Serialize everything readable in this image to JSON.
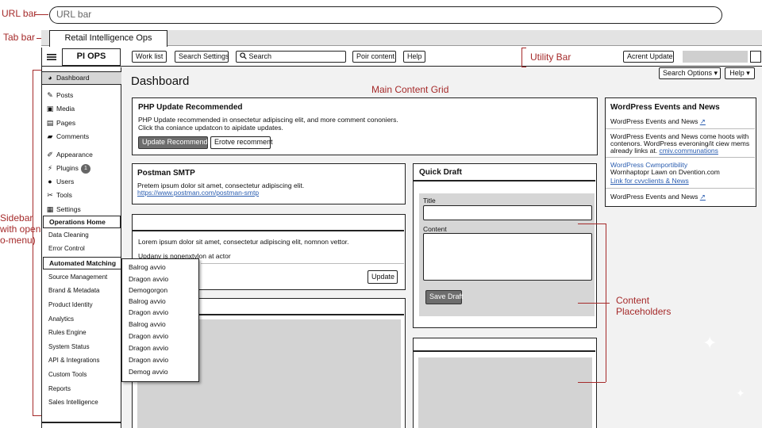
{
  "annotations": {
    "url_bar": "URL bar",
    "tab_bar": "Tab bar",
    "utility_bar": "Utility Bar",
    "main_grid": "Main Content Grid",
    "sidebar_lines": [
      "Sidebar",
      "with open",
      "o-menu)"
    ],
    "content_placeholders": [
      "Content",
      "Placeholders"
    ]
  },
  "browser": {
    "url_placeholder": "URL bar",
    "tab_title": "Retail Intelligence Ops"
  },
  "topbar": {
    "brand": "PI OPS",
    "work_list": "Work list",
    "search_settings": "Search Settings",
    "search_placeholder": "Search",
    "poir_content": "Poir content",
    "help": "Help",
    "acrent_update": "Acrent Update"
  },
  "sidebar": {
    "items": [
      {
        "label": "Dashboard",
        "icon": "gauge-icon"
      },
      {
        "label": "Posts",
        "icon": "pin-icon"
      },
      {
        "label": "Media",
        "icon": "media-icon"
      },
      {
        "label": "Pages",
        "icon": "pages-icon"
      },
      {
        "label": "Comments",
        "icon": "comment-icon"
      },
      {
        "label": "Appearance",
        "icon": "brush-icon"
      },
      {
        "label": "Plugins",
        "icon": "plugin-icon",
        "badge": "1"
      },
      {
        "label": "Users",
        "icon": "user-icon"
      },
      {
        "label": "Tools",
        "icon": "wrench-icon"
      },
      {
        "label": "Settings",
        "icon": "settings-icon"
      }
    ],
    "group1_head": "Operations Home",
    "group1_items": [
      "Data Cleaning",
      "Error Control"
    ],
    "group2_head": "Automated Matching",
    "group2_items": [
      "Source Management",
      "Brand & Metadata",
      "Product Identity",
      "Analytics",
      "Rules Engine",
      "System Status",
      "API & Integrations",
      "Custom Tools",
      "Reports",
      "Sales Intelligence"
    ]
  },
  "submenu": {
    "items": [
      "Balrog avvio",
      "Dragon avvio",
      "Demogorgon",
      "Balrog avvio",
      "Dragon avvio",
      "Balrog avvio",
      "Dragon avvio",
      "Dragon avvio",
      "Dragon avvio",
      "Demog avvio"
    ]
  },
  "main": {
    "title": "Dashboard",
    "search_options": "Search Options ▾",
    "help": "Help ▾",
    "php": {
      "title": "PHP Update Recommended",
      "line1": "PHP Update recommended in onsectetur adipiscing elit, and more comment cononiers.",
      "line2": "Click tha coniance updatcon to aipidate updates.",
      "btn_update": "Update Recommended",
      "btn_other": "Erotve recomment"
    },
    "smtp": {
      "title": "Postman SMTP",
      "line1": "Pretem ipsum dolor sit amet, consectetur adipiscing elit.",
      "link": "https://www.postman.com/postman-smtp"
    },
    "lorem": {
      "line1": "Lorem ipsum dolor sit amet, consectetur adipiscing elit, nomnon vettor.",
      "line2": "Updany is nonenxtylon at actor",
      "btn": "Update"
    },
    "draft": {
      "title": "Quick Draft",
      "title_label": "Title",
      "content_label": "Content",
      "save": "Save Draft"
    },
    "events": {
      "title": "WordPress Events and News",
      "row1": "WordPress Events and News",
      "row2_l1": "WordPress Events and News come hoots with",
      "row2_l2": "contenors. WordPress everoning/it ciew mems",
      "row2_l3_prefix": "already links at.",
      "row2_l3_link": "cmiv.communations",
      "row3_link1": "WordPress Cwmportibility",
      "row3_text": "Wornhaptopr Lawn on Dvention.com",
      "row3_link2": "Link for cvvclients & News",
      "row4": "WordPress Events and News"
    }
  }
}
